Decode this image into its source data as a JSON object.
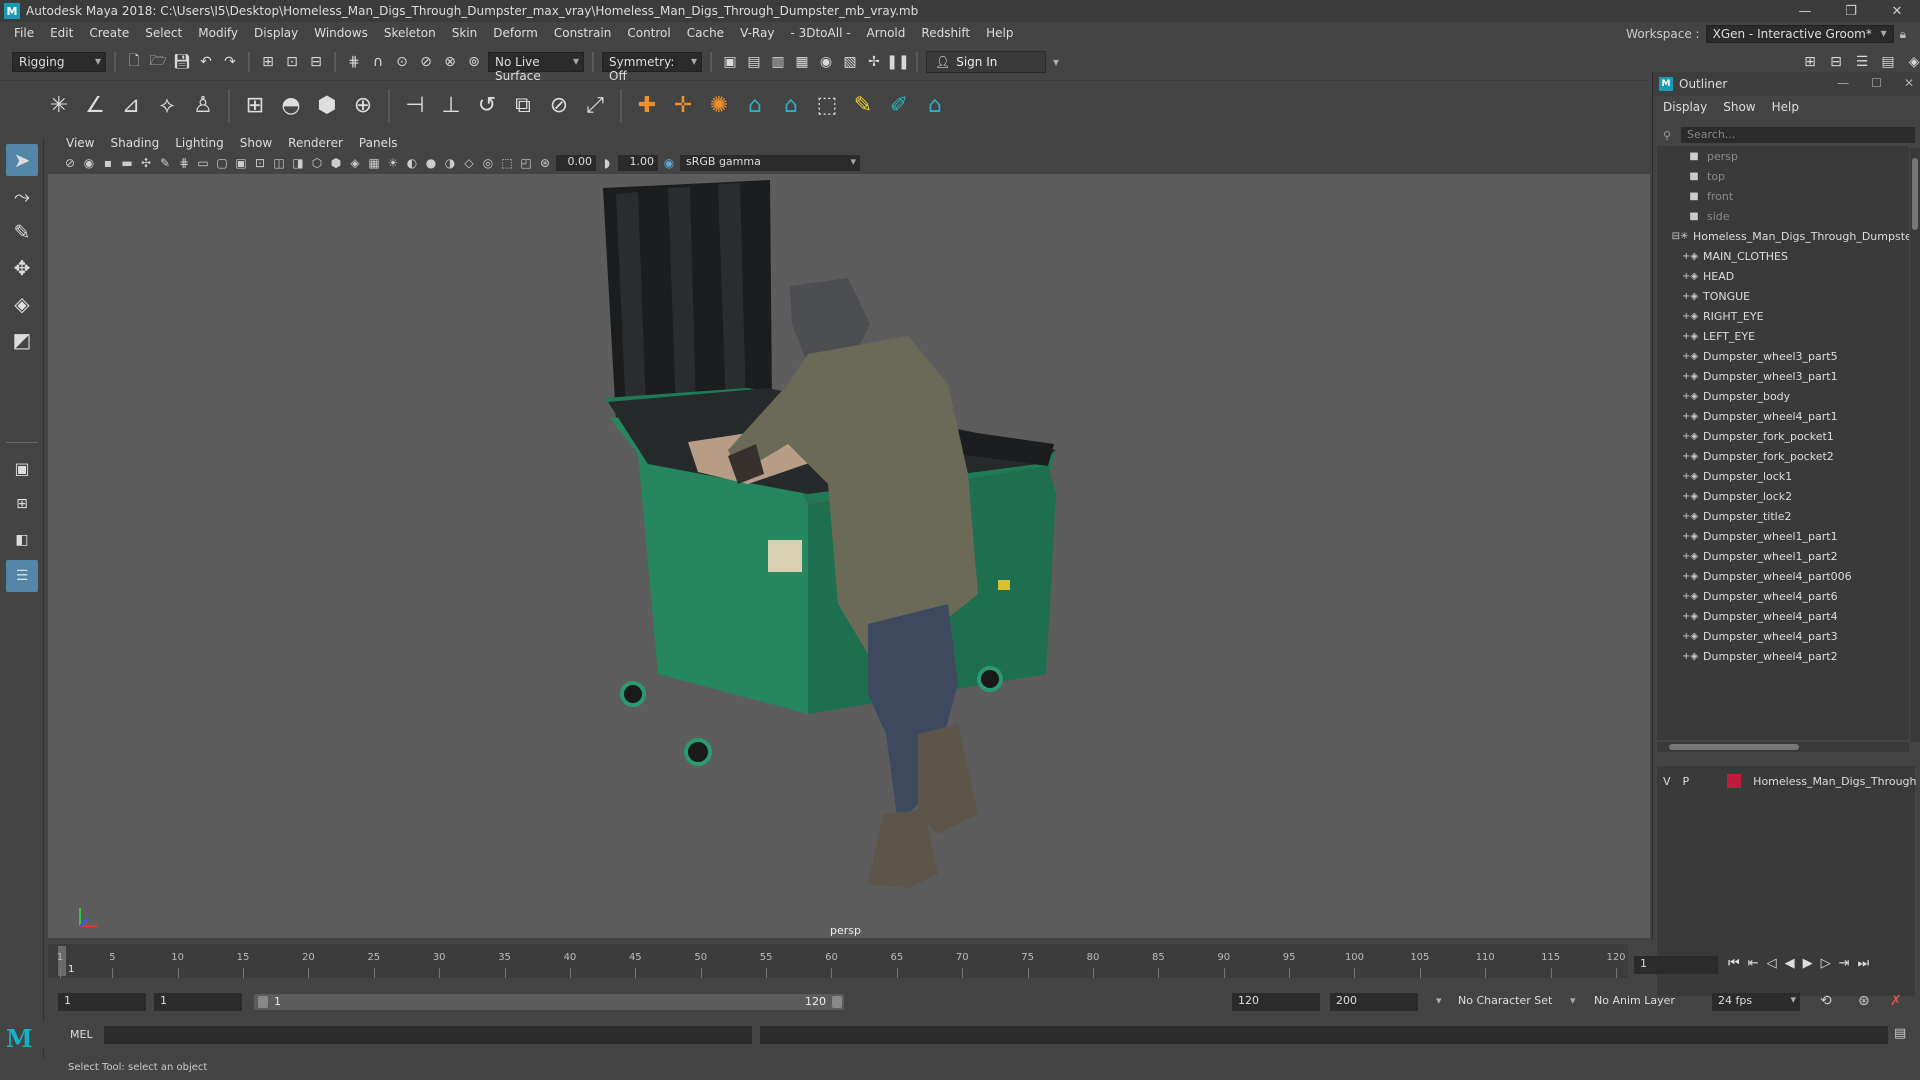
{
  "window": {
    "title": "Autodesk Maya 2018: C:\\Users\\I5\\Desktop\\Homeless_Man_Digs_Through_Dumpster_max_vray\\Homeless_Man_Digs_Through_Dumpster_mb_vray.mb",
    "logo": "M"
  },
  "menubar": [
    "File",
    "Edit",
    "Create",
    "Select",
    "Modify",
    "Display",
    "Windows",
    "Skeleton",
    "Skin",
    "Deform",
    "Constrain",
    "Control",
    "Cache",
    "V-Ray",
    "- 3DtoAll -",
    "Arnold",
    "Redshift",
    "Help"
  ],
  "workspace": {
    "label": "Workspace :",
    "value": "XGen - Interactive Groom*"
  },
  "statusline": {
    "mode": "Rigging",
    "live_surface": "No Live Surface",
    "symmetry": "Symmetry: Off",
    "sign_in": "Sign In"
  },
  "viewport": {
    "menu": [
      "View",
      "Shading",
      "Lighting",
      "Show",
      "Renderer",
      "Panels"
    ],
    "exposure": "0.00",
    "gamma_value": "1.00",
    "color_space": "sRGB gamma",
    "camera": "persp"
  },
  "outliner": {
    "title": "Outliner",
    "menu": [
      "Display",
      "Show",
      "Help"
    ],
    "search_placeholder": "Search...",
    "cameras": [
      "persp",
      "top",
      "front",
      "side"
    ],
    "root": "Homeless_Man_Digs_Through_Dumpster",
    "children": [
      "MAIN_CLOTHES",
      "HEAD",
      "TONGUE",
      "RIGHT_EYE",
      "LEFT_EYE",
      "Dumpster_wheel3_part5",
      "Dumpster_wheel3_part1",
      "Dumpster_body",
      "Dumpster_wheel4_part1",
      "Dumpster_fork_pocket1",
      "Dumpster_fork_pocket2",
      "Dumpster_lock1",
      "Dumpster_lock2",
      "Dumpster_title2",
      "Dumpster_wheel1_part1",
      "Dumpster_wheel1_part2",
      "Dumpster_wheel4_part006",
      "Dumpster_wheel4_part6",
      "Dumpster_wheel4_part4",
      "Dumpster_wheel4_part3",
      "Dumpster_wheel4_part2"
    ],
    "layer": {
      "v": "V",
      "p": "P",
      "name": "Homeless_Man_Digs_Through",
      "color": "#c01a3c"
    }
  },
  "timeline": {
    "ticks": [
      "1",
      "5",
      "10",
      "15",
      "20",
      "25",
      "30",
      "35",
      "40",
      "45",
      "50",
      "55",
      "60",
      "65",
      "70",
      "75",
      "80",
      "85",
      "90",
      "95",
      "100",
      "105",
      "110",
      "115",
      "120"
    ],
    "current_frame": "1"
  },
  "range": {
    "start": "1",
    "anim_start": "1",
    "range_start": "1",
    "range_end": "120",
    "anim_end": "120",
    "end": "200",
    "character_set": "No Character Set",
    "anim_layer": "No Anim Layer",
    "fps": "24 fps"
  },
  "command": {
    "label": "MEL",
    "help": "Select Tool: select an object"
  }
}
